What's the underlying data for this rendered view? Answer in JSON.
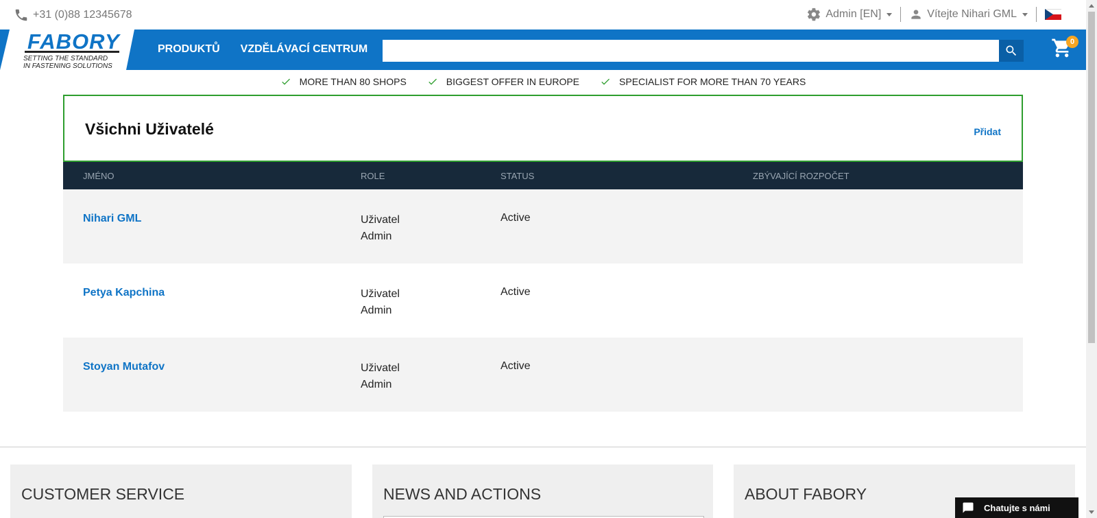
{
  "topbar": {
    "phone": "+31 (0)88 12345678",
    "admin_label": "Admin [EN]",
    "welcome_label": "Vítejte Nihari GML",
    "flag": "czech-flag"
  },
  "header": {
    "logo": {
      "name": "FABORY",
      "tagline_1": "SETTING THE STANDARD",
      "tagline_2": "IN FASTENING SOLUTIONS"
    },
    "nav": [
      "PRODUKTŮ",
      "VZDĚLÁVACÍ CENTRUM"
    ],
    "search": {
      "value": "",
      "placeholder": ""
    },
    "cart_count": "0",
    "colors": {
      "brand_blue": "#0f74c6",
      "dark_header": "#17293a",
      "accent_green": "#2e9e2e",
      "badge_orange": "#f6a623"
    }
  },
  "usps": [
    "MORE THAN 80 SHOPS",
    "BIGGEST OFFER IN EUROPE",
    "SPECIALIST FOR MORE THAN 70 YEARS"
  ],
  "panel": {
    "title": "Všichni Uživatelé",
    "add_label": "Přidat"
  },
  "table": {
    "headers": [
      "JMÉNO",
      "ROLE",
      "STATUS",
      "ZBÝVAJÍCÍ ROZPOČET"
    ],
    "rows": [
      {
        "name": "Nihari GML",
        "role_1": "Uživatel",
        "role_2": "Admin",
        "status": "Active",
        "budget": ""
      },
      {
        "name": "Petya Kapchina",
        "role_1": "Uživatel",
        "role_2": "Admin",
        "status": "Active",
        "budget": ""
      },
      {
        "name": "Stoyan Mutafov",
        "role_1": "Uživatel",
        "role_2": "Admin",
        "status": "Active",
        "budget": ""
      }
    ]
  },
  "footer": {
    "columns": [
      "CUSTOMER SERVICE",
      "NEWS AND ACTIONS",
      "ABOUT FABORY"
    ]
  },
  "chat": {
    "label": "Chatujte s námi"
  }
}
